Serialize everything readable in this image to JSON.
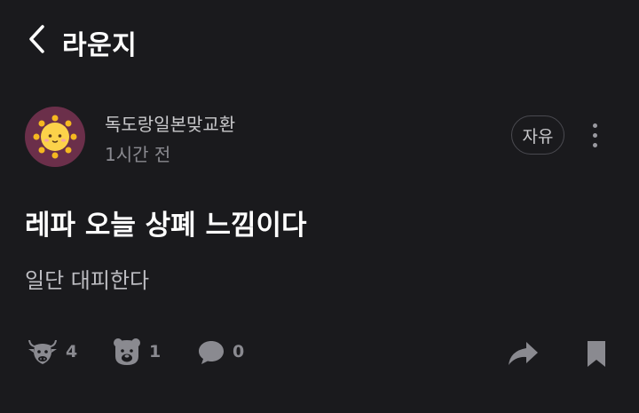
{
  "header": {
    "back_icon": "chevron-left-icon",
    "title": "라운지"
  },
  "post": {
    "author": {
      "avatar_icon": "sun-face-icon",
      "avatar_bg": "#6b2f4a",
      "name": "독도랑일본맞교환",
      "time": "1시간 전"
    },
    "tag": "자유",
    "more_icon": "more-vertical-icon",
    "title": "레파 오늘 상폐 느낌이다",
    "body": "일단 대피한다",
    "actions": {
      "bull": {
        "icon": "bull-icon",
        "count": "4"
      },
      "bear": {
        "icon": "bear-icon",
        "count": "1"
      },
      "comment": {
        "icon": "comment-icon",
        "count": "0"
      },
      "share_icon": "share-icon",
      "bookmark_icon": "bookmark-icon"
    }
  },
  "colors": {
    "background": "#1a1a1d",
    "primary_text": "#ffffff",
    "secondary_text": "#8a8a90",
    "icon_gray": "#8a8a90"
  }
}
